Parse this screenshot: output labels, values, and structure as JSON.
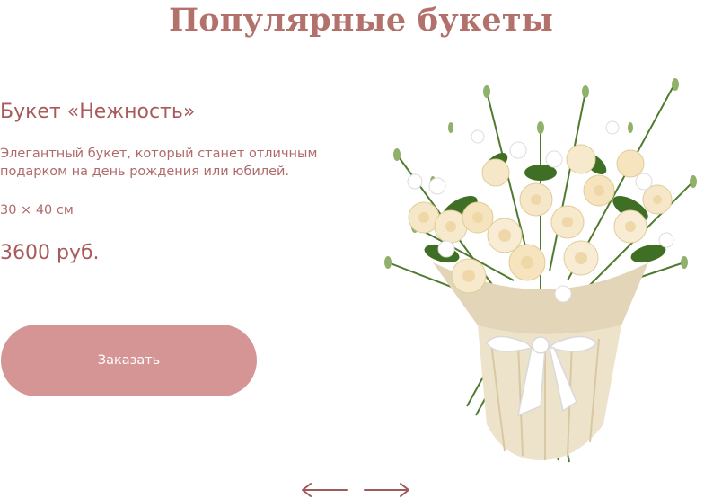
{
  "section": {
    "title": "Популярные букеты"
  },
  "product": {
    "name": "Букет «Нежность»",
    "description": "Элегантный букет, который станет отличным подарком на день рождения или юбилей.",
    "size": "30 × 40 см",
    "price": "3600 руб.",
    "order_label": "Заказать"
  },
  "carousel": {
    "prev_icon": "arrow-left-icon",
    "next_icon": "arrow-right-icon"
  },
  "colors": {
    "accent": "#b2716b",
    "text": "#a95a5b",
    "button": "#d59595",
    "button_text": "#ffffff"
  }
}
